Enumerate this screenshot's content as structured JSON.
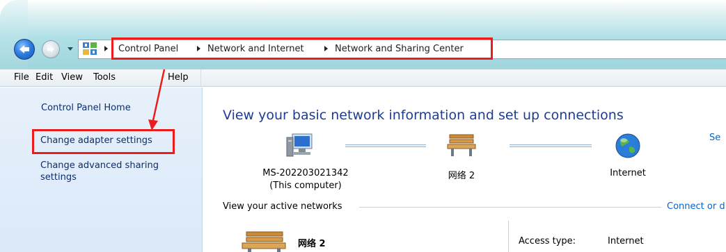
{
  "breadcrumb": {
    "items": [
      "Control Panel",
      "Network and Internet",
      "Network and Sharing Center"
    ]
  },
  "menu": {
    "items": [
      "File",
      "Edit",
      "View",
      "Tools",
      "Help"
    ]
  },
  "sidebar": {
    "links": [
      "Control Panel Home",
      "Change adapter settings",
      "Change advanced sharing settings"
    ]
  },
  "main": {
    "title": "View your basic network information and set up connections",
    "see_link": "Se",
    "map": {
      "computer_name": "MS-202203021342",
      "computer_sub": "(This computer)",
      "network": "网络 2",
      "internet": "Internet"
    },
    "active_networks_label": "View your active networks",
    "connect_link": "Connect or d",
    "active_network": {
      "name": "网络 2",
      "access_type_label": "Access type:",
      "access_type_value": "Internet"
    }
  },
  "colors": {
    "annotation_red": "#ea1c1c",
    "link_blue": "#0066cc",
    "title_blue": "#1e3d8f"
  }
}
